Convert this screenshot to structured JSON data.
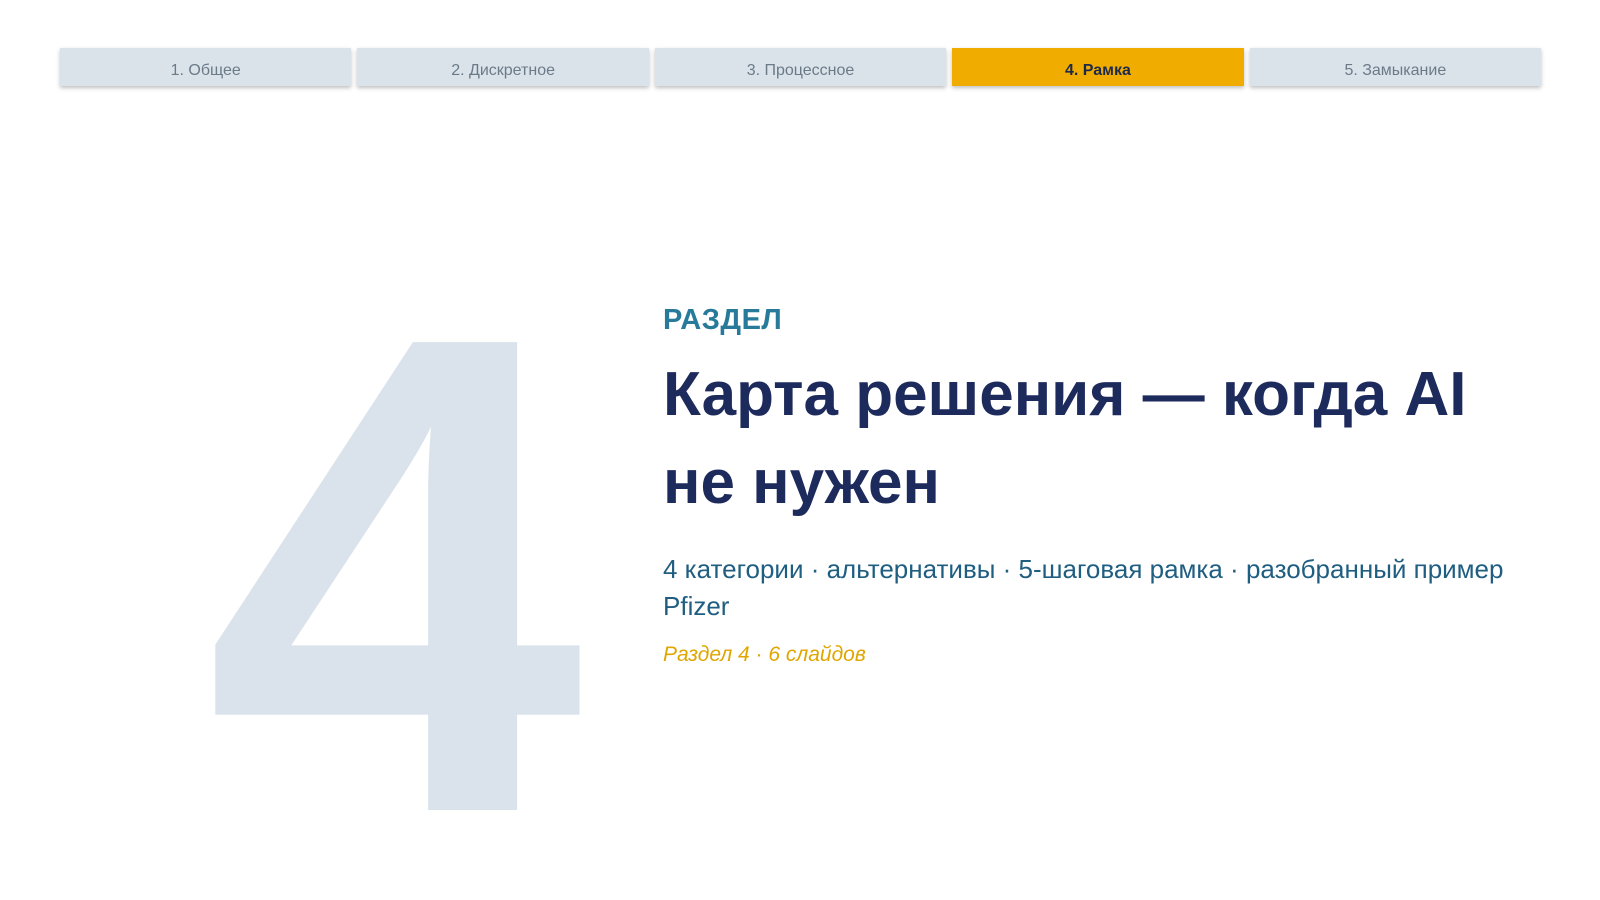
{
  "nav": {
    "tabs": [
      {
        "label": "1. Общее",
        "active": false
      },
      {
        "label": "2. Дискретное",
        "active": false
      },
      {
        "label": "3. Процессное",
        "active": false
      },
      {
        "label": "4. Рамка",
        "active": true
      },
      {
        "label": "5. Замыкание",
        "active": false
      }
    ]
  },
  "section": {
    "number": "4",
    "kicker": "РАЗДЕЛ",
    "title": "Карта решения — когда AI не нужен",
    "subtitle": "4 категории · альтернативы · 5-шаговая рамка · разобранный пример Pfizer",
    "meta": "Раздел 4 · 6 слайдов"
  },
  "colors": {
    "accent": "#f0ad00",
    "tab_inactive": "#dbe3ea",
    "title": "#1d2a5c",
    "kicker": "#277a9a",
    "subtitle": "#1f5e80",
    "number_watermark": "#dae3eb"
  }
}
